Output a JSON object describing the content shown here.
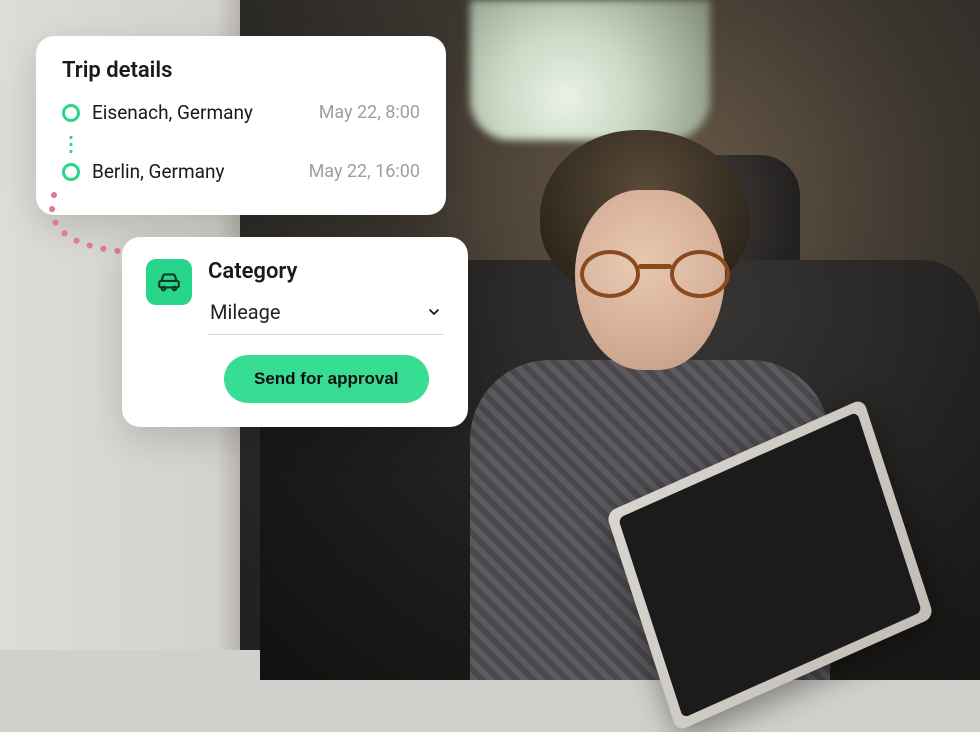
{
  "colors": {
    "accent": "#27d68a",
    "button": "#38dd94",
    "text": "#1a1a1a",
    "muted": "#9aa0a3"
  },
  "trip": {
    "title": "Trip details",
    "stops": [
      {
        "location": "Eisenach, Germany",
        "time": "May 22, 8:00"
      },
      {
        "location": "Berlin, Germany",
        "time": "May 22, 16:00"
      }
    ]
  },
  "category": {
    "icon": "car-icon",
    "title": "Category",
    "selected_value": "Mileage",
    "submit_label": "Send for approval"
  }
}
